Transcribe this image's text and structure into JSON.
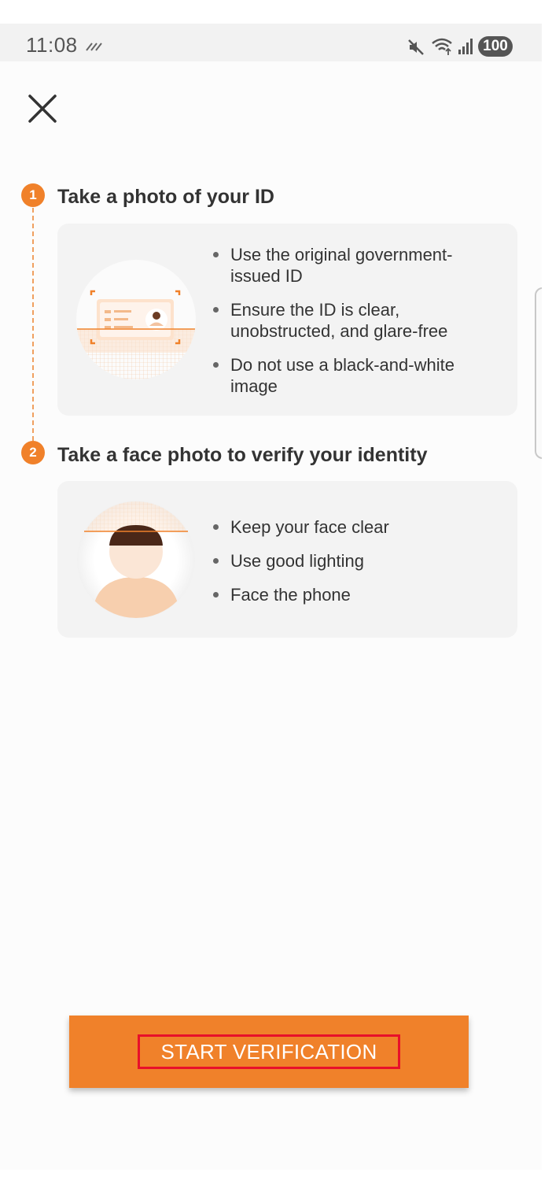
{
  "status_bar": {
    "time": "11:08",
    "battery": "100",
    "icons": [
      "bars-icon",
      "mute-icon",
      "wifi-icon",
      "signal-icon",
      "battery-icon"
    ]
  },
  "header": {
    "close_icon": "close-icon"
  },
  "steps": [
    {
      "number": "1",
      "title": "Take a photo of your ID",
      "illustration": "id-card-icon",
      "bullets": [
        "Use the original government-issued ID",
        "Ensure the ID is clear, unobstructed, and glare-free",
        "Do not use a black-and-white image"
      ]
    },
    {
      "number": "2",
      "title": "Take a face photo to verify your identity",
      "illustration": "face-icon",
      "bullets": [
        "Keep your face clear",
        "Use good lighting",
        "Face the phone"
      ]
    }
  ],
  "primary_action": {
    "label": "START VERIFICATION"
  },
  "colors": {
    "accent": "#f0812a",
    "card_background": "#f3f3f3",
    "text": "#333333",
    "highlight_border": "#e8102a"
  }
}
